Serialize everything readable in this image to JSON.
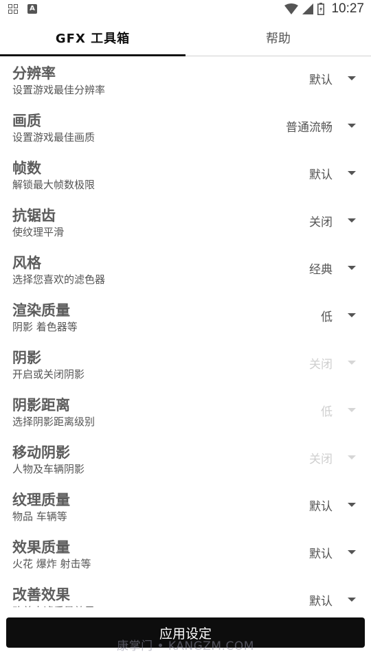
{
  "status_bar": {
    "time": "10:27",
    "left_icons": [
      "grid-icon",
      "a-letter-icon"
    ],
    "right_icons": [
      "wifi-icon",
      "cellular-icon",
      "battery-icon"
    ]
  },
  "tabs": [
    {
      "label": "GFX 工具箱",
      "active": true
    },
    {
      "label": "帮助",
      "active": false
    }
  ],
  "settings": [
    {
      "title": "分辨率",
      "subtitle": "设置游戏最佳分辨率",
      "value": "默认",
      "enabled": true
    },
    {
      "title": "画质",
      "subtitle": "设置游戏最佳画质",
      "value": "普通流畅",
      "enabled": true
    },
    {
      "title": "帧数",
      "subtitle": "解锁最大帧数极限",
      "value": "默认",
      "enabled": true
    },
    {
      "title": "抗锯齿",
      "subtitle": "使纹理平滑",
      "value": "关闭",
      "enabled": true
    },
    {
      "title": "风格",
      "subtitle": "选择您喜欢的滤色器",
      "value": "经典",
      "enabled": true
    },
    {
      "title": "渲染质量",
      "subtitle": "阴影 着色器等",
      "value": "低",
      "enabled": true
    },
    {
      "title": "阴影",
      "subtitle": "开启或关闭阴影",
      "value": "关闭",
      "enabled": false
    },
    {
      "title": "阴影距离",
      "subtitle": "选择阴影距离级别",
      "value": "低",
      "enabled": false
    },
    {
      "title": "移动阴影",
      "subtitle": "人物及车辆阴影",
      "value": "关闭",
      "enabled": false
    },
    {
      "title": "纹理质量",
      "subtitle": "物品 车辆等",
      "value": "默认",
      "enabled": true
    },
    {
      "title": "效果质量",
      "subtitle": "火花 爆炸 射击等",
      "value": "默认",
      "enabled": true
    },
    {
      "title": "改善效果",
      "subtitle": "改善水滤质量效果",
      "value": "默认",
      "enabled": true
    }
  ],
  "apply_button": {
    "label": "应用设定"
  },
  "watermark": "康掌门 • KANGZM.COM",
  "colors": {
    "accent": "#111111",
    "disabled": "#cfcfcf",
    "button_bg": "#0d0d0d"
  }
}
